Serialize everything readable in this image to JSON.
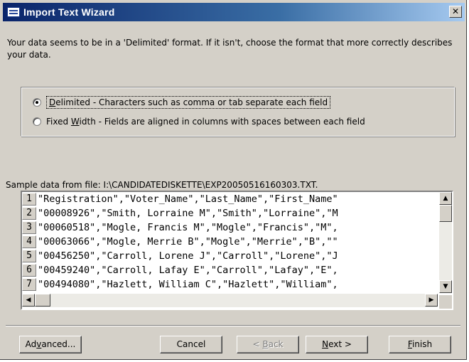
{
  "window": {
    "title": "Import Text Wizard",
    "close_glyph": "✕"
  },
  "intro": "Your data seems to be in a 'Delimited' format. If it isn't, choose the format that more correctly describes your data.",
  "options": [
    {
      "label_prefix": "",
      "accel": "D",
      "label_rest": "elimited - Characters such as comma or tab separate each field",
      "checked": true
    },
    {
      "label_prefix": "Fixed ",
      "accel": "W",
      "label_rest": "idth - Fields are aligned in columns with spaces between each field",
      "checked": false
    }
  ],
  "sample": {
    "label": "Sample data from file: I:\\CANDIDATEDISKETTE\\EXP20050516160303.TXT.",
    "rows": [
      {
        "num": "1",
        "text": "\"Registration\",\"Voter_Name\",\"Last_Name\",\"First_Name\""
      },
      {
        "num": "2",
        "text": "\"00008926\",\"Smith, Lorraine M\",\"Smith\",\"Lorraine\",\"M"
      },
      {
        "num": "3",
        "text": "\"00060518\",\"Mogle, Francis M\",\"Mogle\",\"Francis\",\"M\","
      },
      {
        "num": "4",
        "text": "\"00063066\",\"Mogle, Merrie B\",\"Mogle\",\"Merrie\",\"B\",\"\""
      },
      {
        "num": "5",
        "text": "\"00456250\",\"Carroll, Lorene J\",\"Carroll\",\"Lorene\",\"J"
      },
      {
        "num": "6",
        "text": "\"00459240\",\"Carroll, Lafay E\",\"Carroll\",\"Lafay\",\"E\","
      },
      {
        "num": "7",
        "text": "\"00494080\",\"Hazlett, William C\",\"Hazlett\",\"William\","
      }
    ]
  },
  "scrollbar": {
    "up_icon": "up-arrow-icon",
    "down_icon": "down-arrow-icon",
    "left_icon": "left-arrow-icon",
    "right_icon": "right-arrow-icon"
  },
  "buttons": {
    "advanced": {
      "pre": "Ad",
      "accel": "v",
      "post": "anced..."
    },
    "cancel": {
      "label": "Cancel"
    },
    "back": {
      "pre": "< ",
      "accel": "B",
      "post": "ack",
      "disabled": true
    },
    "next": {
      "pre": "",
      "accel": "N",
      "post": "ext >"
    },
    "finish": {
      "pre": "",
      "accel": "F",
      "post": "inish"
    }
  }
}
